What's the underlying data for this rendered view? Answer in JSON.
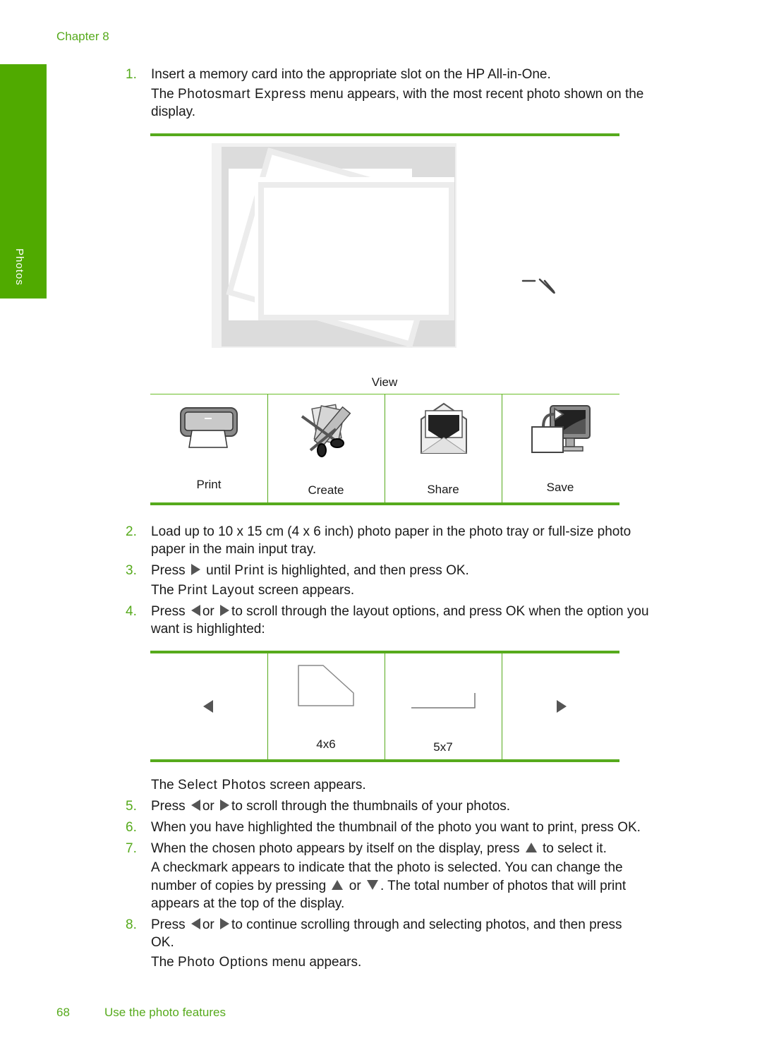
{
  "header": {
    "chapter": "Chapter 8"
  },
  "side_tab": {
    "label": "Photos"
  },
  "steps": {
    "s1": {
      "num": "1.",
      "text": "Insert a memory card into the appropriate slot on the HP All-in-One.",
      "p1_a": "The ",
      "p1_mono": "Photosmart Express",
      "p1_b": " menu appears, with the most recent photo shown on the",
      "p1_c": "display."
    },
    "s2": {
      "num": "2.",
      "line1": "Load up to 10 x 15 cm (4 x 6 inch) photo paper in the photo tray or full-size photo",
      "line2": "paper in the main input tray."
    },
    "s3": {
      "num": "3.",
      "a": "Press",
      "b": "until",
      "mono": "Print",
      "c": "is highlighted, and then press OK.",
      "p_a": "The",
      "p_mono": "Print Layout",
      "p_b": "screen appears."
    },
    "s4": {
      "num": "4.",
      "a": "Press",
      "or": "or",
      "b": "to scroll through the layout options, and press OK when the option you",
      "line2": "want is highlighted:"
    },
    "select_photos": {
      "a": "The",
      "mono": "Select Photos",
      "b": "screen appears."
    },
    "s5": {
      "num": "5.",
      "a": "Press",
      "or": "or",
      "b": "to scroll through the thumbnails of your photos."
    },
    "s6": {
      "num": "6.",
      "text": "When you have highlighted the thumbnail of the photo you want to print, press OK."
    },
    "s7": {
      "num": "7.",
      "a": "When the chosen photo appears by itself on the display, press",
      "b": "to select it.",
      "p1": "A checkmark appears to indicate that the photo is selected. You can change the",
      "p2_a": "number of copies by pressing",
      "p2_or": "or",
      "p2_b": ". The total number of photos that will print",
      "p3": "appears at the top of the display."
    },
    "s8": {
      "num": "8.",
      "a": "Press",
      "or": "or",
      "b": "to continue scrolling through and selecting photos, and then press",
      "line2": "OK.",
      "p_a": "The",
      "p_mono": "Photo Options",
      "p_b": "menu appears."
    }
  },
  "express_menu": {
    "top_label": "View",
    "items": [
      {
        "label": "Print",
        "icon": "printer-icon"
      },
      {
        "label": "Create",
        "icon": "scissors-icon"
      },
      {
        "label": "Share",
        "icon": "envelope-icon"
      },
      {
        "label": "Save",
        "icon": "save-to-computer-icon"
      }
    ]
  },
  "layout_menu": {
    "items": [
      {
        "label": "",
        "icon": "left-arrow-icon"
      },
      {
        "label": "4x6",
        "icon": "layout-4x6-icon"
      },
      {
        "label": "5x7",
        "icon": "layout-5x7-icon"
      },
      {
        "label": "",
        "icon": "right-arrow-icon"
      }
    ]
  },
  "footer": {
    "page_number": "68",
    "title": "Use the photo features"
  },
  "colors": {
    "accent": "#56aa1c",
    "side_tab": "#50aa00"
  }
}
